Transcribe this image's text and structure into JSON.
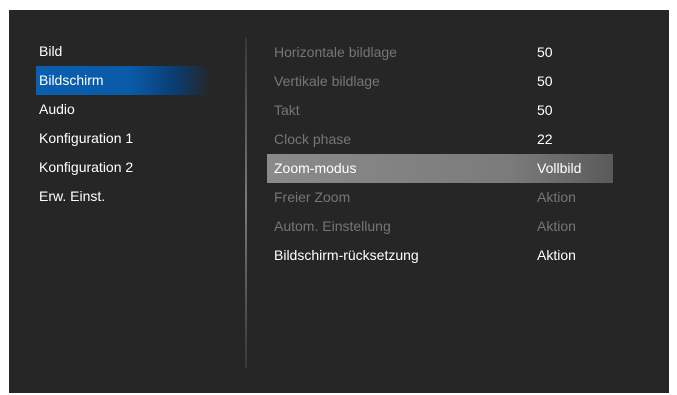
{
  "left_menu": {
    "items": [
      {
        "label": "Bild"
      },
      {
        "label": "Bildschirm"
      },
      {
        "label": "Audio"
      },
      {
        "label": "Konfiguration 1"
      },
      {
        "label": "Konfiguration 2"
      },
      {
        "label": "Erw. Einst."
      }
    ]
  },
  "settings": {
    "rows": [
      {
        "label": "Horizontale bildlage",
        "value": "50"
      },
      {
        "label": "Vertikale bildlage",
        "value": "50"
      },
      {
        "label": "Takt",
        "value": "50"
      },
      {
        "label": "Clock phase",
        "value": "22"
      },
      {
        "label": "Zoom-modus",
        "value": "Vollbild"
      },
      {
        "label": "Freier Zoom",
        "value": "Aktion"
      },
      {
        "label": "Autom. Einstellung",
        "value": "Aktion"
      },
      {
        "label": "Bildschirm-rücksetzung",
        "value": "Aktion"
      }
    ]
  }
}
